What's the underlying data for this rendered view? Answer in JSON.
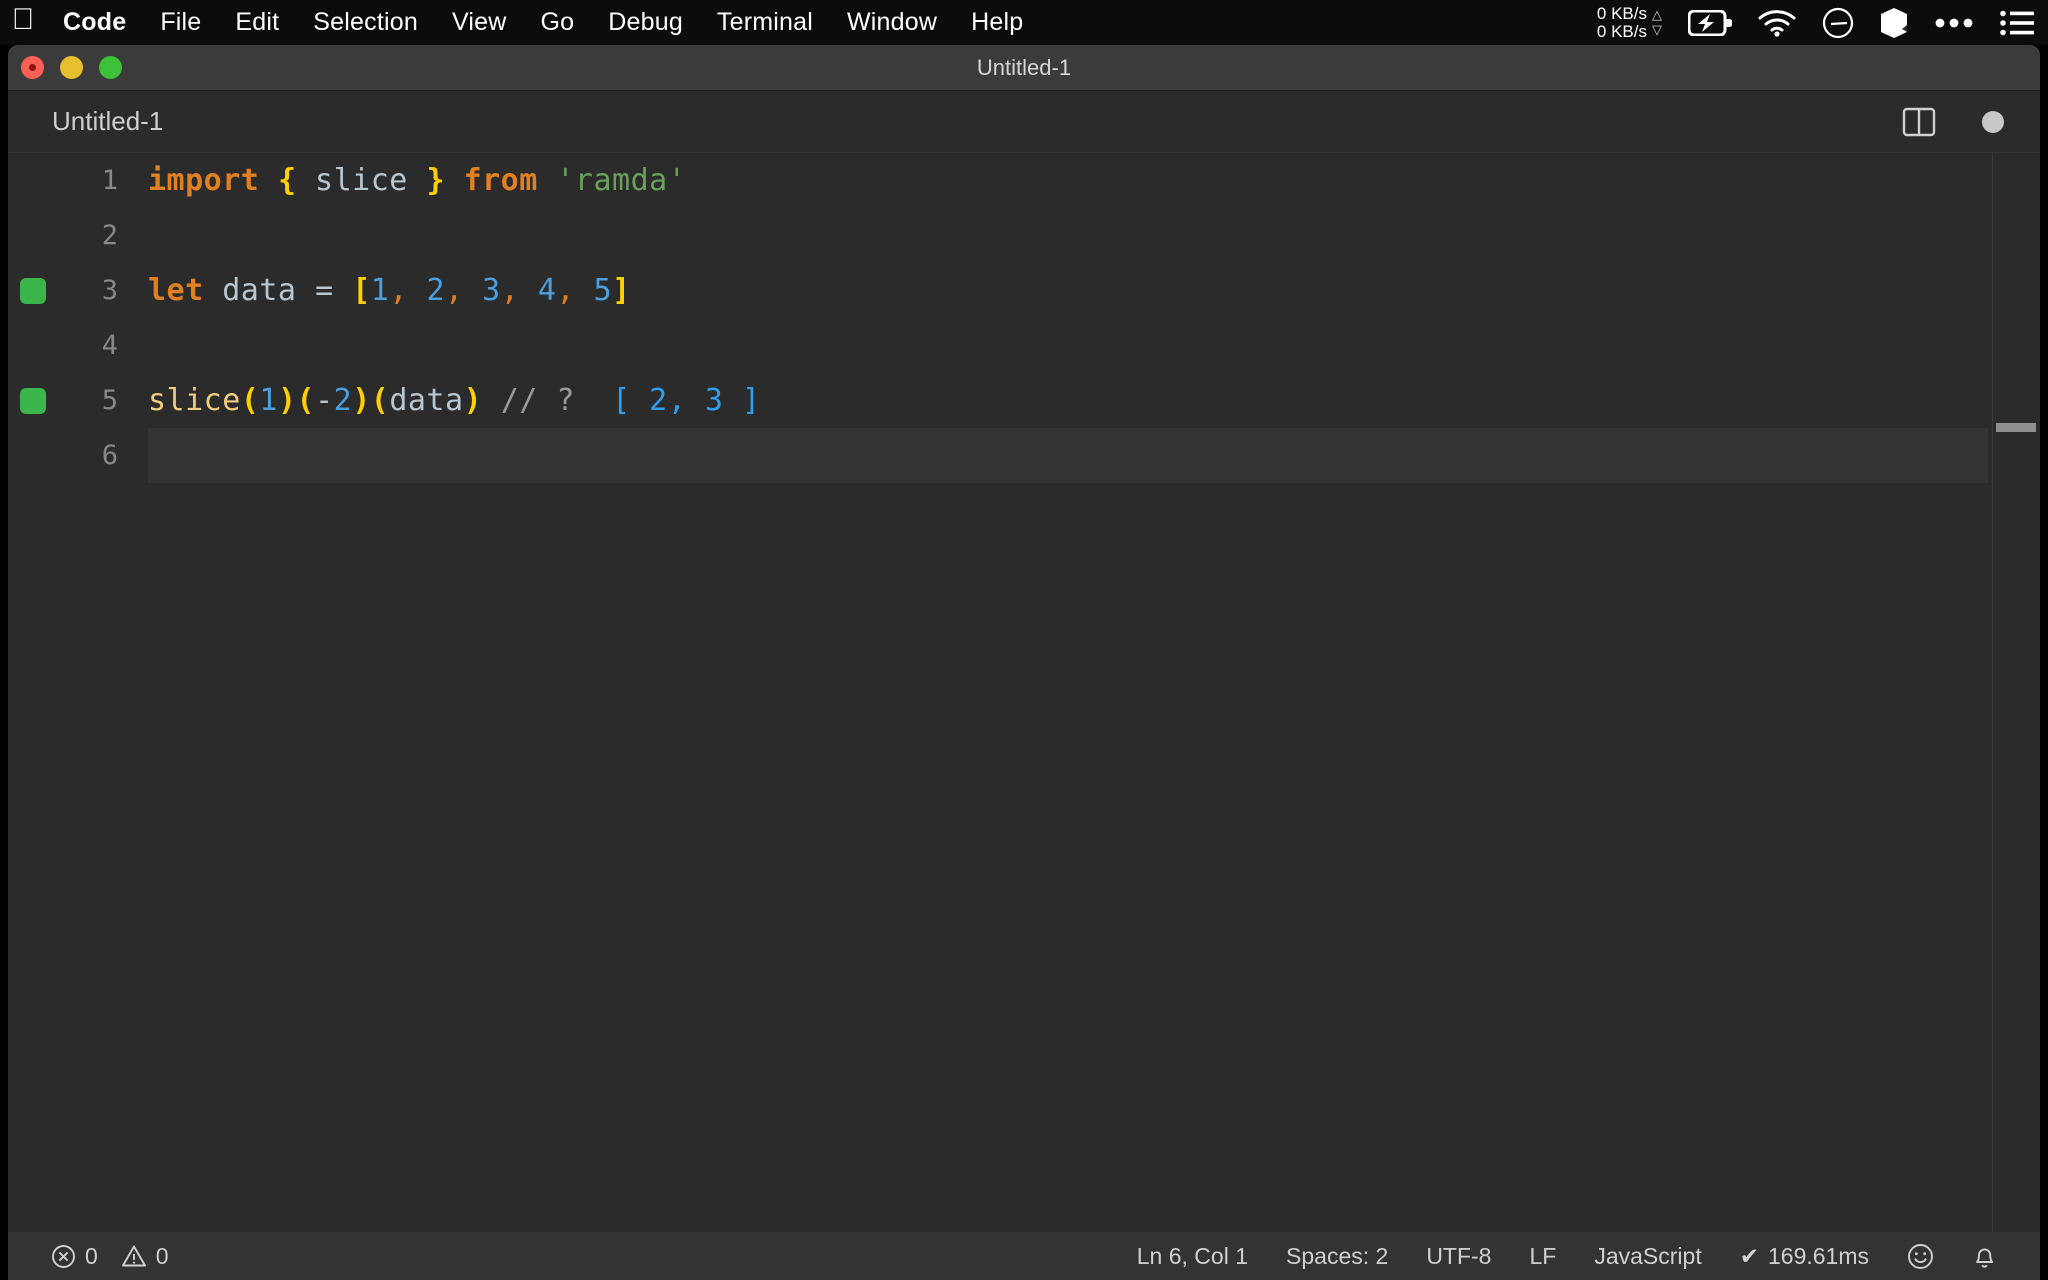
{
  "menubar": {
    "apple_icon": "apple-logo-icon",
    "items": [
      {
        "label": "Code",
        "bold": true
      },
      {
        "label": "File",
        "bold": false
      },
      {
        "label": "Edit",
        "bold": false
      },
      {
        "label": "Selection",
        "bold": false
      },
      {
        "label": "View",
        "bold": false
      },
      {
        "label": "Go",
        "bold": false
      },
      {
        "label": "Debug",
        "bold": false
      },
      {
        "label": "Terminal",
        "bold": false
      },
      {
        "label": "Window",
        "bold": false
      },
      {
        "label": "Help",
        "bold": false
      }
    ],
    "tray": {
      "upload_rate": "0 KB/s",
      "download_rate": "0 KB/s",
      "up_arrow": "△",
      "down_arrow": "▽",
      "icons": [
        "battery-charging-icon",
        "wifi-icon",
        "clock-icon",
        "cube-icon",
        "ellipsis-icon",
        "list-icon"
      ]
    }
  },
  "window": {
    "title": "Untitled-1",
    "traffic_lights": [
      "close-button",
      "minimize-button",
      "zoom-button"
    ]
  },
  "tabs": {
    "items": [
      {
        "label": "Untitled-1",
        "active": true,
        "dirty": true
      }
    ],
    "actions": [
      "split-editor-button",
      "unsaved-indicator"
    ]
  },
  "editor": {
    "lines": [
      {
        "number": "1",
        "marker": null,
        "current": false,
        "tokens": [
          {
            "t": "import",
            "c": "tok-kw"
          },
          {
            "t": " ",
            "c": "tok-var"
          },
          {
            "t": "{",
            "c": "tok-brace"
          },
          {
            "t": " slice ",
            "c": "tok-var"
          },
          {
            "t": "}",
            "c": "tok-brace"
          },
          {
            "t": " ",
            "c": "tok-var"
          },
          {
            "t": "from",
            "c": "tok-kw"
          },
          {
            "t": " ",
            "c": "tok-var"
          },
          {
            "t": "'ramda'",
            "c": "tok-str"
          }
        ]
      },
      {
        "number": "2",
        "marker": null,
        "current": false,
        "tokens": []
      },
      {
        "number": "3",
        "marker": "#3cb54a",
        "current": false,
        "tokens": [
          {
            "t": "let",
            "c": "tok-kw"
          },
          {
            "t": " data ",
            "c": "tok-var"
          },
          {
            "t": "=",
            "c": "tok-op"
          },
          {
            "t": " ",
            "c": "tok-var"
          },
          {
            "t": "[",
            "c": "tok-brace"
          },
          {
            "t": "1",
            "c": "tok-num"
          },
          {
            "t": ",",
            "c": "tok-comma"
          },
          {
            "t": " ",
            "c": "tok-var"
          },
          {
            "t": "2",
            "c": "tok-num"
          },
          {
            "t": ",",
            "c": "tok-comma"
          },
          {
            "t": " ",
            "c": "tok-var"
          },
          {
            "t": "3",
            "c": "tok-num"
          },
          {
            "t": ",",
            "c": "tok-comma"
          },
          {
            "t": " ",
            "c": "tok-var"
          },
          {
            "t": "4",
            "c": "tok-num"
          },
          {
            "t": ",",
            "c": "tok-comma"
          },
          {
            "t": " ",
            "c": "tok-var"
          },
          {
            "t": "5",
            "c": "tok-num"
          },
          {
            "t": "]",
            "c": "tok-brace"
          }
        ]
      },
      {
        "number": "4",
        "marker": null,
        "current": false,
        "tokens": []
      },
      {
        "number": "5",
        "marker": "#3cb54a",
        "current": false,
        "tokens": [
          {
            "t": "slice",
            "c": "tok-fn"
          },
          {
            "t": "(",
            "c": "tok-paren"
          },
          {
            "t": "1",
            "c": "tok-num"
          },
          {
            "t": ")",
            "c": "tok-paren"
          },
          {
            "t": "(",
            "c": "tok-paren"
          },
          {
            "t": "-",
            "c": "tok-op"
          },
          {
            "t": "2",
            "c": "tok-num"
          },
          {
            "t": ")",
            "c": "tok-paren"
          },
          {
            "t": "(",
            "c": "tok-paren"
          },
          {
            "t": "data",
            "c": "tok-var"
          },
          {
            "t": ")",
            "c": "tok-paren"
          },
          {
            "t": " ",
            "c": "tok-var"
          },
          {
            "t": "// ?",
            "c": "tok-comment"
          },
          {
            "t": "  ",
            "c": "tok-var"
          },
          {
            "t": "[ 2, 3 ]",
            "c": "tok-result"
          }
        ]
      },
      {
        "number": "6",
        "marker": null,
        "current": true,
        "tokens": []
      }
    ]
  },
  "statusbar": {
    "errors_icon": "error-circle-icon",
    "errors": "0",
    "warnings_icon": "warning-triangle-icon",
    "warnings": "0",
    "cursor_position": "Ln 6, Col 1",
    "indentation": "Spaces: 2",
    "encoding": "UTF-8",
    "line_ending": "LF",
    "language": "JavaScript",
    "run_check": "✔",
    "run_time": "169.61ms",
    "feedback_icon": "smiley-icon",
    "notifications_icon": "bell-icon"
  }
}
